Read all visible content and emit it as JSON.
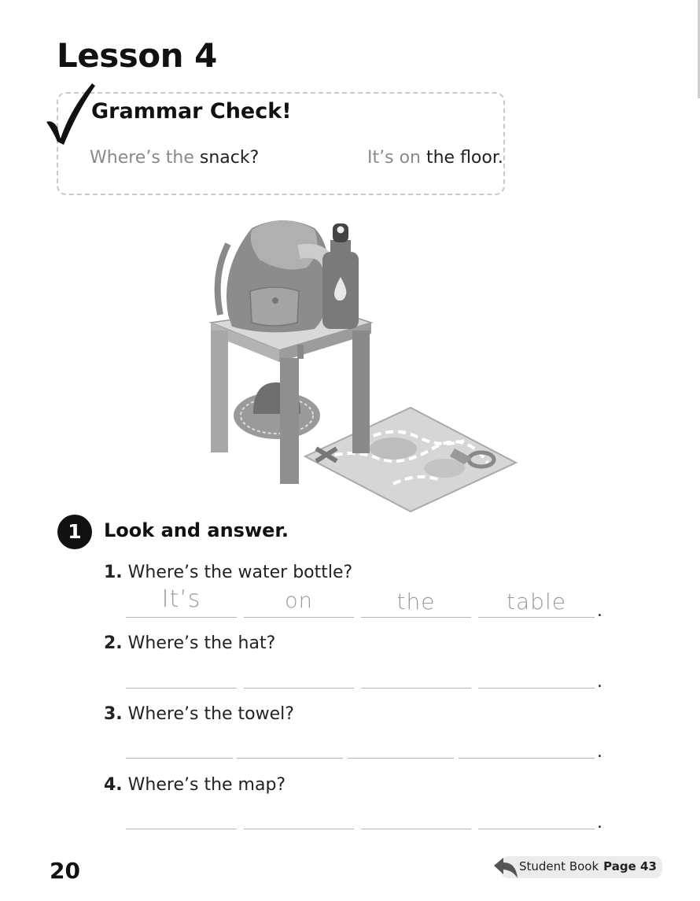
{
  "lesson": {
    "title": "Lesson 4"
  },
  "grammar_check": {
    "title": "Grammar Check!",
    "question": {
      "part1": "Where’s the",
      "part2": "snack?"
    },
    "answer": {
      "part1": "It’s on",
      "part2": "the floor."
    }
  },
  "exercise": {
    "number": "1",
    "title": "Look and answer.",
    "questions": [
      {
        "num": "1.",
        "text": "Where’s the water bottle?",
        "answer": [
          "It’s",
          "on",
          "the",
          "table"
        ]
      },
      {
        "num": "2.",
        "text": "Where’s the hat?",
        "answer": [
          "",
          "",
          "",
          ""
        ]
      },
      {
        "num": "3.",
        "text": "Where’s the towel?",
        "answer": [
          "",
          "",
          "",
          ""
        ]
      },
      {
        "num": "4.",
        "text": "Where’s the map?",
        "answer": [
          "",
          "",
          "",
          ""
        ]
      }
    ],
    "period": "."
  },
  "footer": {
    "page_number": "20",
    "reference_label": "Student Book",
    "reference_page": "Page 43"
  },
  "colors": {
    "text": "#111111",
    "grey_text": "#8a8a8a",
    "box_border": "#c9c9c9",
    "line": "#b5b5b5"
  }
}
